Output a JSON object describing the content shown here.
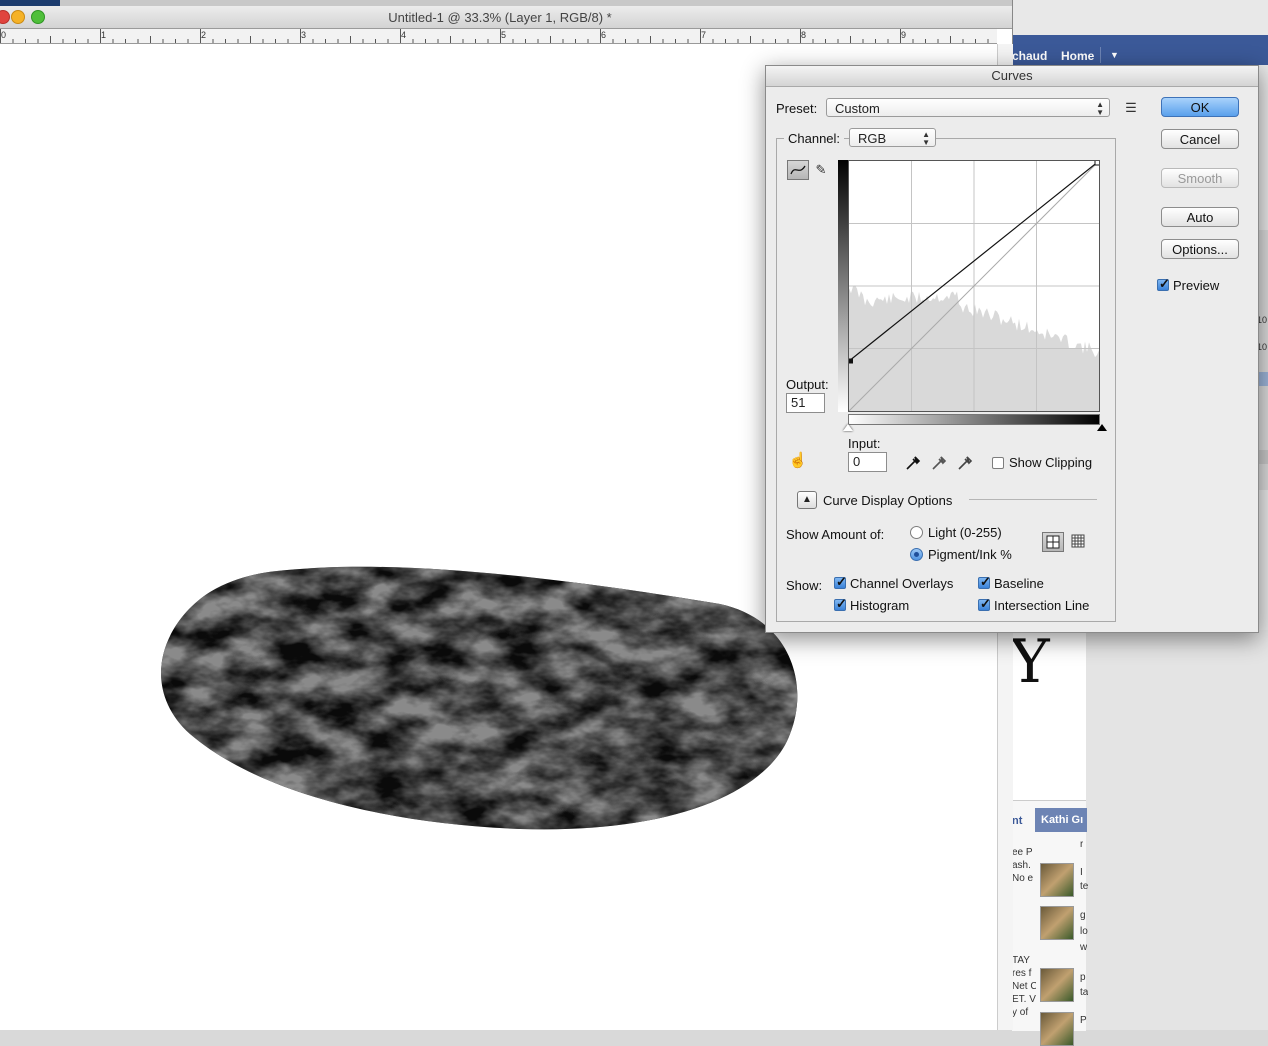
{
  "document": {
    "title": "Untitled-1 @ 33.3% (Layer 1, RGB/8) *",
    "ruler_numbers": [
      "0",
      "1",
      "2",
      "3",
      "4",
      "5",
      "6",
      "7",
      "8",
      "9"
    ]
  },
  "browser": {
    "nav_user": "chaud",
    "nav_home": "Home",
    "partial_n": "nt",
    "chat_name": "Kathi Gı",
    "chat_r": "r",
    "left_text": [
      "ee P",
      "ash.",
      "No e"
    ],
    "left_text2": [
      "TAY",
      "res f",
      "Net C",
      "ET. V",
      "y of "
    ],
    "msg_frag": [
      "I",
      "te",
      "g",
      "lo",
      "w",
      "p",
      "ta",
      "P"
    ],
    "big_letter": "Y"
  },
  "curves": {
    "title": "Curves",
    "preset_label": "Preset:",
    "preset_value": "Custom",
    "channel_label": "Channel:",
    "channel_value": "RGB",
    "output_label": "Output:",
    "output_value": "51",
    "input_label": "Input:",
    "input_value": "0",
    "show_clipping": "Show Clipping",
    "curve_display_options": "Curve Display Options",
    "show_amount_label": "Show Amount of:",
    "light_option": "Light  (0-255)",
    "pigment_option": "Pigment/Ink %",
    "show_label": "Show:",
    "channel_overlays": "Channel Overlays",
    "baseline": "Baseline",
    "histogram": "Histogram",
    "intersection_line": "Intersection Line",
    "buttons": {
      "ok": "OK",
      "cancel": "Cancel",
      "smooth": "Smooth",
      "auto": "Auto",
      "options": "Options..."
    },
    "preview": "Preview",
    "icons": {
      "curve_tool": "curve-edit-icon",
      "pencil_tool": "pencil-icon",
      "hand_tool": "targeted-adjust-hand-icon",
      "preset_menu": "preset-menu-icon",
      "eyedropper_black": "black-point-eyedropper-icon",
      "eyedropper_gray": "gray-point-eyedropper-icon",
      "eyedropper_white": "white-point-eyedropper-icon",
      "grid_simple": "simple-grid-icon",
      "grid_detailed": "detailed-grid-icon",
      "collapse": "collapse-triangle-icon"
    },
    "curve_points": [
      {
        "input": 0,
        "output": 51
      },
      {
        "input": 255,
        "output": 255
      }
    ],
    "states": {
      "preview_checked": true,
      "show_clipping_checked": false,
      "pigment_selected": true,
      "channel_overlays_checked": true,
      "baseline_checked": true,
      "histogram_checked": true,
      "intersection_checked": true
    }
  },
  "colors": {
    "ok_button": "#5aa0ec",
    "facebook_blue": "#3b5998"
  }
}
